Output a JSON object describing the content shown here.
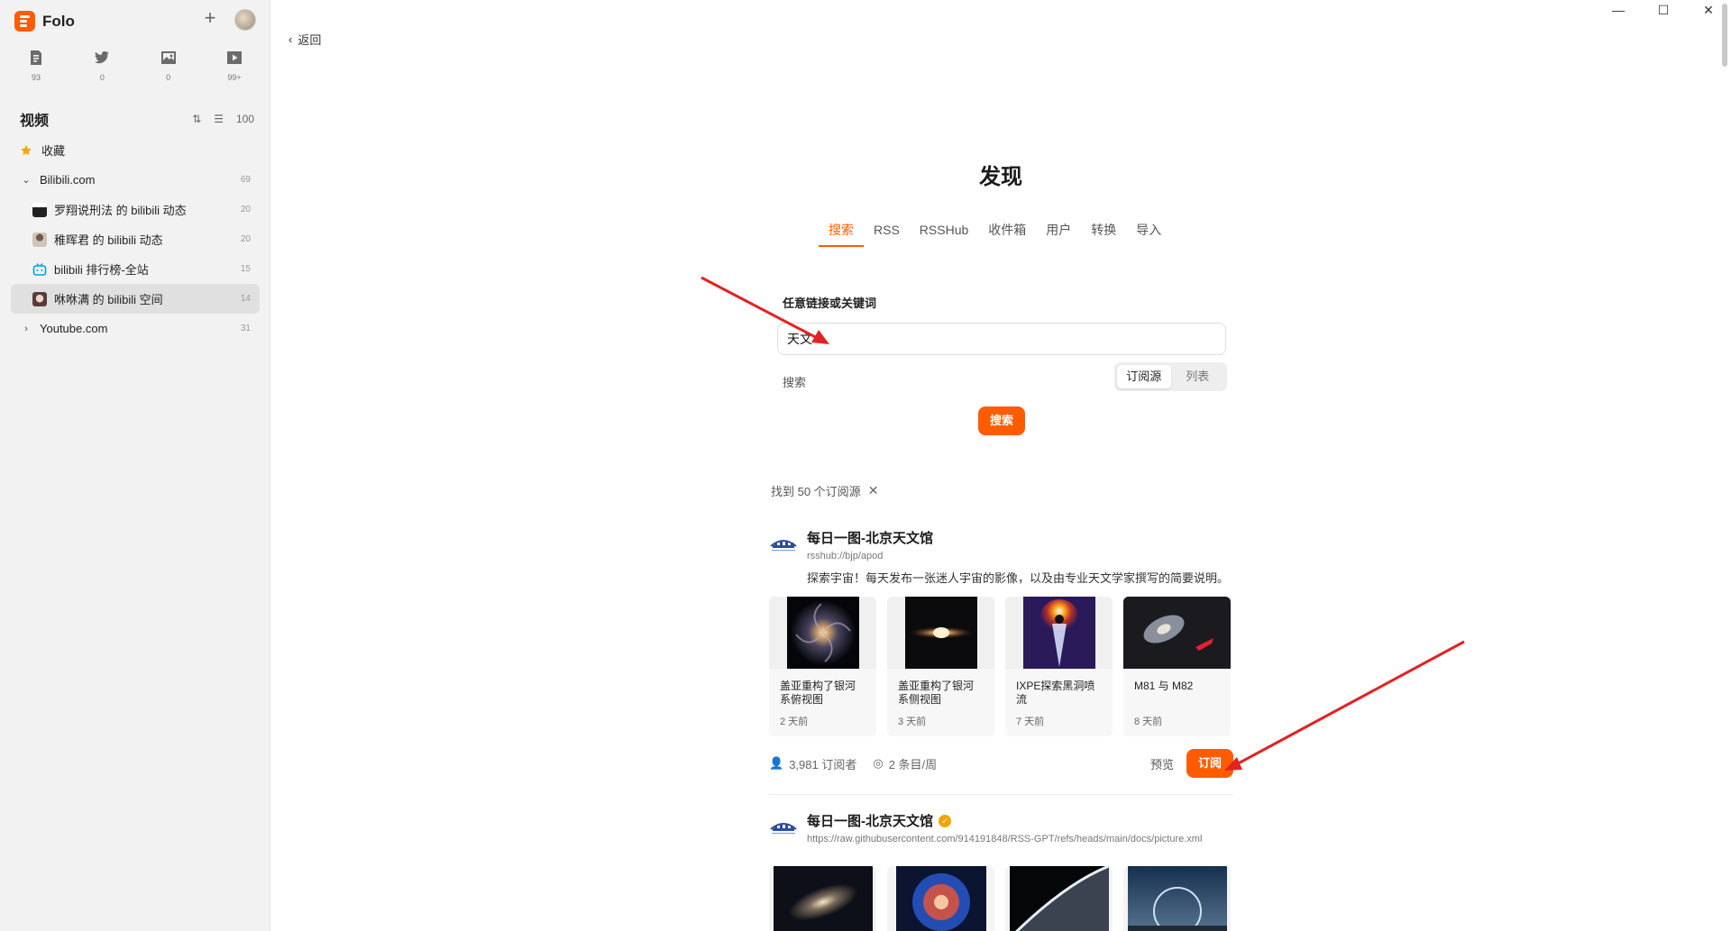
{
  "app": {
    "name": "Folo"
  },
  "views": [
    {
      "icon": "article-icon",
      "count": "93"
    },
    {
      "icon": "bird-icon",
      "count": "0"
    },
    {
      "icon": "picture-icon",
      "count": "0"
    },
    {
      "icon": "video-icon",
      "count": "99+"
    }
  ],
  "sidebar": {
    "section_title": "视频",
    "unread_total": "100",
    "items": [
      {
        "label": "收藏",
        "count": ""
      },
      {
        "label": "Bilibili.com",
        "count": "69"
      },
      {
        "label": "罗翔说刑法 的 bilibili 动态",
        "count": "20"
      },
      {
        "label": "稚晖君 的 bilibili 动态",
        "count": "20"
      },
      {
        "label": "bilibili 排行榜-全站",
        "count": "15"
      },
      {
        "label": "咻咻满 的 bilibili 空间",
        "count": "14"
      },
      {
        "label": "Youtube.com",
        "count": "31"
      }
    ]
  },
  "window": {
    "minimize": "—",
    "maximize": "☐",
    "close": "✕"
  },
  "nav": {
    "back": "返回"
  },
  "discover": {
    "title": "发现",
    "tabs": [
      "搜索",
      "RSS",
      "RSSHub",
      "收件箱",
      "用户",
      "转换",
      "导入"
    ],
    "form_label": "任意链接或关键词",
    "query": "天文",
    "mode_label": "搜索",
    "modes": [
      "订阅源",
      "列表"
    ],
    "search_button": "搜索",
    "results_text": "找到 50 个订阅源"
  },
  "results": [
    {
      "name": "每日一图-北京天文馆",
      "url": "rsshub://bjp/apod",
      "description": "探索宇宙！每天发布一张迷人宇宙的影像，以及由专业天文学家撰写的简要说明。",
      "entries": [
        {
          "title": "盖亚重构了银河系俯视图",
          "time": "2 天前"
        },
        {
          "title": "盖亚重构了银河系侧视图",
          "time": "3 天前"
        },
        {
          "title": "IXPE探索黑洞喷流",
          "time": "7 天前"
        },
        {
          "title": "M81 与 M82",
          "time": "8 天前"
        }
      ],
      "subscribers": "3,981 订阅者",
      "frequency": "2 条目/周",
      "preview": "预览",
      "subscribe": "订阅"
    },
    {
      "name": "每日一图-北京天文馆",
      "url": "https://raw.githubusercontent.com/914191848/RSS-GPT/refs/heads/main/docs/picture.xml"
    }
  ],
  "colors": {
    "accent": "#ff5c00",
    "annotation_arrow": "#e02424"
  }
}
